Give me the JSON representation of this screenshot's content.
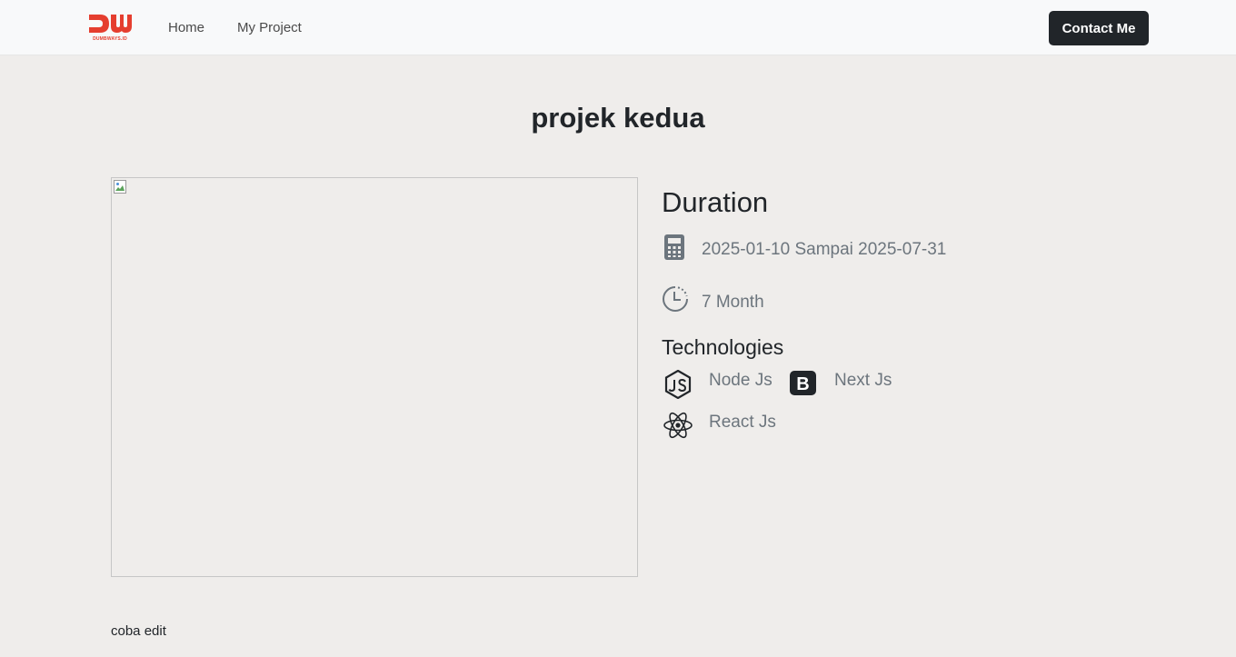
{
  "navbar": {
    "logo_text": "DW",
    "logo_subtext": "DUMBWAYS.ID",
    "links": [
      {
        "label": "Home"
      },
      {
        "label": "My Project"
      }
    ],
    "contact_label": "Contact Me",
    "colors": {
      "background": "#f8f9fa",
      "brand": "#e53e2f",
      "button": "#212529"
    }
  },
  "project": {
    "title": "projek kedua",
    "image_icon": "broken-image-icon",
    "duration_heading": "Duration",
    "date_icon": "calculator-icon",
    "date_range": "2025-01-10 Sampai 2025-07-31",
    "duration_icon": "clock-icon",
    "duration_value": "7 Month",
    "technologies_heading": "Technologies",
    "technologies": [
      {
        "label": "Node Js",
        "icon": "nodejs-icon"
      },
      {
        "label": "Next Js",
        "icon": "bootstrap-icon"
      },
      {
        "label": "React Js",
        "icon": "react-icon"
      }
    ],
    "description": "coba edit"
  },
  "colors": {
    "page_background": "#efedeb",
    "muted_text": "#6c757d",
    "heading_text": "#212529"
  }
}
